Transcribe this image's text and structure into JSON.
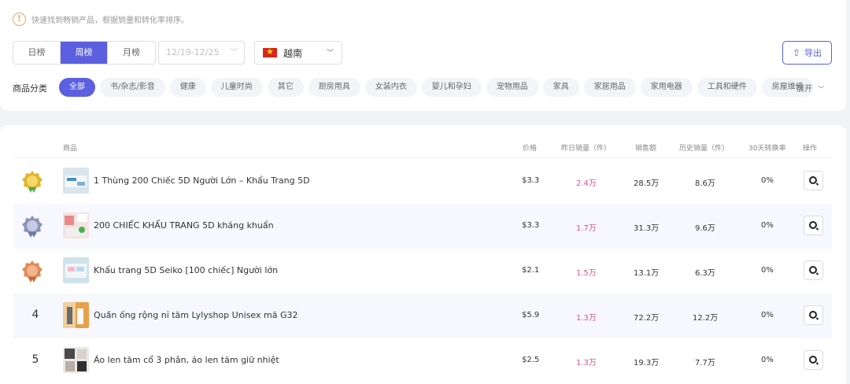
{
  "tip": {
    "text": "快速找到畅销产品，根据销量和转化率排序。"
  },
  "period_tabs": [
    {
      "label": "日榜",
      "active": false
    },
    {
      "label": "周榜",
      "active": true
    },
    {
      "label": "月榜",
      "active": false
    }
  ],
  "date_select": {
    "value": "12/19-12/25"
  },
  "country_select": {
    "value": "越南",
    "flag": "vietnam-flag"
  },
  "export_button": {
    "label": "导出"
  },
  "category_label": "商品分类",
  "categories": [
    {
      "label": "全部",
      "active": true
    },
    {
      "label": "书/杂志/影音"
    },
    {
      "label": "健康"
    },
    {
      "label": "儿童时尚"
    },
    {
      "label": "其它"
    },
    {
      "label": "厨房用具"
    },
    {
      "label": "女装内衣"
    },
    {
      "label": "婴儿和孕妇"
    },
    {
      "label": "宠物用品"
    },
    {
      "label": "家具"
    },
    {
      "label": "家居用品"
    },
    {
      "label": "家用电器"
    },
    {
      "label": "工具和硬件"
    },
    {
      "label": "房屋维修"
    }
  ],
  "expand_label": "展开",
  "table": {
    "headers": {
      "product": "商品",
      "price": "价格",
      "yesterday_sales": "昨日销量（件）",
      "revenue": "销售额",
      "total_sales": "历史销量（件）",
      "conversion": "30天转换率",
      "action": "操作"
    },
    "rows": [
      {
        "rank": "1",
        "medal": "gold",
        "name": "1 Thùng 200 Chiếc 5D Người Lớn – Khẩu Trang 5D",
        "price": "$3.3",
        "yesterday_sales": "2.4万",
        "revenue": "28.5万",
        "total_sales": "8.6万",
        "conversion": "0%"
      },
      {
        "rank": "2",
        "medal": "silver",
        "name": "200 CHIẾC KHẨU TRANG 5D kháng khuẩn",
        "price": "$3.3",
        "yesterday_sales": "1.7万",
        "revenue": "31.3万",
        "total_sales": "9.6万",
        "conversion": "0%"
      },
      {
        "rank": "3",
        "medal": "bronze",
        "name": "Khẩu trang 5D Seiko [100 chiếc] Người lớn",
        "price": "$2.1",
        "yesterday_sales": "1.5万",
        "revenue": "13.1万",
        "total_sales": "6.3万",
        "conversion": "0%"
      },
      {
        "rank": "4",
        "medal": "",
        "name": "Quần ống rộng nỉ tăm Lylyshop Unisex mã G32",
        "price": "$5.9",
        "yesterday_sales": "1.3万",
        "revenue": "72.2万",
        "total_sales": "12.2万",
        "conversion": "0%"
      },
      {
        "rank": "5",
        "medal": "",
        "name": "Áo len tăm cổ 3 phân, áo len tăm giữ nhiệt",
        "price": "$2.5",
        "yesterday_sales": "1.3万",
        "revenue": "19.3万",
        "total_sales": "7.7万",
        "conversion": "0%"
      }
    ]
  },
  "colors": {
    "accent": "#5b5fe0",
    "sales_pink": "#e0518e",
    "gold": "#e0b52a",
    "silver": "#8b95b8",
    "bronze": "#e08a5a"
  }
}
